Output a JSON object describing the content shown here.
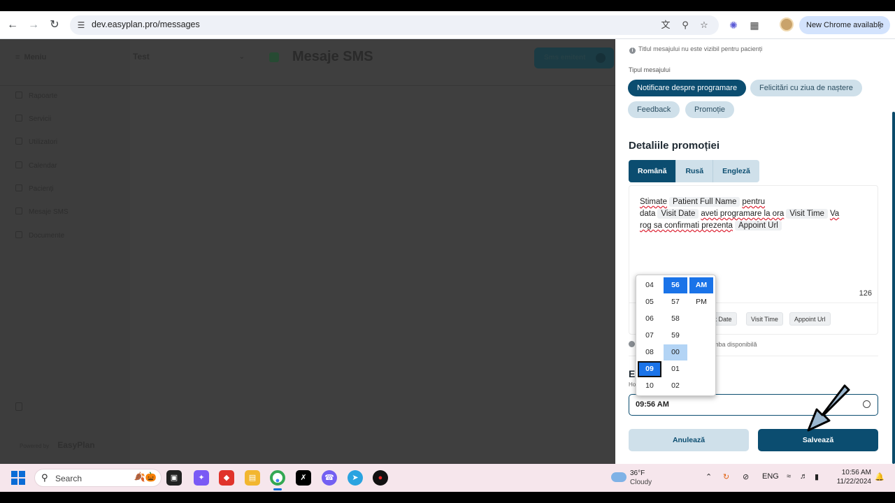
{
  "browser": {
    "url": "dev.easyplan.pro/messages",
    "update_label": "New Chrome available"
  },
  "app": {
    "menu_label": "Meniu",
    "sidebar_items": [
      "Rapoarte",
      "Servicii",
      "Utilizatori",
      "Calendar",
      "Pacienți",
      "Mesaje SMS",
      "Documente"
    ],
    "org_selector": "Test",
    "page_title": "Mesaje SMS",
    "header_button": "Sms emitent",
    "powered_by": "Powered by",
    "brand": "EasyPlan"
  },
  "panel": {
    "title_hint": "Titlul mesajului nu este vizibil pentru pacienți",
    "type_label": "Tipul mesajului",
    "types": [
      {
        "label": "Notificare despre programare",
        "active": true
      },
      {
        "label": "Felicitări cu ziua de naștere",
        "active": false
      },
      {
        "label": "Feedback",
        "active": false
      },
      {
        "label": "Promoție",
        "active": false
      }
    ],
    "section_title": "Detaliile promoției",
    "languages": [
      {
        "label": "Română",
        "active": true
      },
      {
        "label": "Rusă",
        "active": false
      },
      {
        "label": "Engleză",
        "active": false
      }
    ],
    "message": {
      "w1": "Stimate",
      "tag1": "Patient Full Name",
      "w2": "pentru",
      "w3": "data",
      "tag2": "Visit Date",
      "w4": "aveti programare la ora",
      "tag3": "Visit Time",
      "w5": "Va",
      "w6": "rog sa confirmati prezenta",
      "tag4": "Appoint Url"
    },
    "char_count": "126",
    "insert_tags": [
      "sit Date",
      "Visit Time",
      "Appoint Url"
    ],
    "lang_hint": "mba disponibilă",
    "schedule_title": "E",
    "schedule_sub": "Ho",
    "time_value": "09:56 AM",
    "cancel_label": "Anulează",
    "save_label": "Salvează"
  },
  "time_picker": {
    "hours": [
      "04",
      "05",
      "06",
      "07",
      "08",
      "09",
      "10"
    ],
    "minutes": [
      "56",
      "57",
      "58",
      "59",
      "00",
      "01",
      "02"
    ],
    "meridiem": [
      "AM",
      "PM"
    ],
    "selected_hour": "09",
    "selected_minute": "56",
    "selected_meridiem": "AM",
    "hovered_minute": "00"
  },
  "taskbar": {
    "search_placeholder": "Search",
    "weather_temp": "36°F",
    "weather_desc": "Cloudy",
    "language": "ENG",
    "time": "10:56 AM",
    "date": "11/22/2024"
  },
  "colors": {
    "primary": "#0b4d70",
    "chip_bg": "#cfe0ea",
    "picker_selected": "#1a73e8"
  }
}
